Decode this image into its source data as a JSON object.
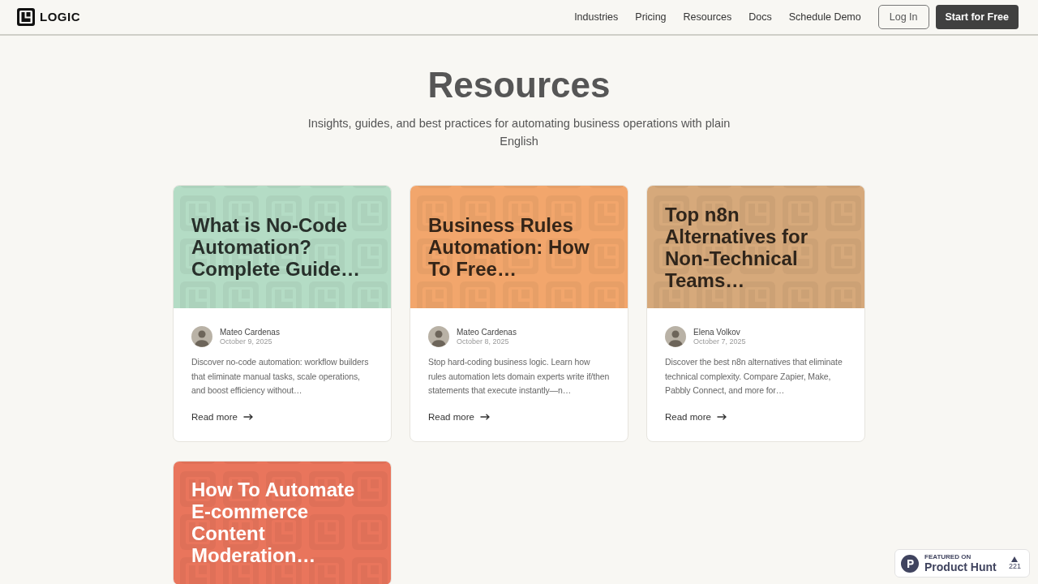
{
  "header": {
    "logo": "LOGIC",
    "nav": [
      "Industries",
      "Pricing",
      "Resources",
      "Docs",
      "Schedule Demo"
    ],
    "login": "Log In",
    "cta": "Start for Free"
  },
  "hero": {
    "title": "Resources",
    "subtitle": "Insights, guides, and best practices for automating business operations with plain English"
  },
  "posts": [
    {
      "title": "What is No-Code Automation? Complete Guide…",
      "color": "#b4dcc5",
      "author": "Mateo Cardenas",
      "date": "October 9, 2025",
      "excerpt": "Discover no-code automation: workflow builders that eliminate manual tasks, scale operations, and boost efficiency without…",
      "link": "Read more"
    },
    {
      "title": "Business Rules Automation: How To Free…",
      "color": "#f2a66c",
      "author": "Mateo Cardenas",
      "date": "October 8, 2025",
      "excerpt": "Stop hard-coding business logic. Learn how rules automation lets domain experts write if/then statements that execute instantly—n…",
      "link": "Read more"
    },
    {
      "title": "Top n8n Alternatives for Non-Technical Teams…",
      "color": "#d6a97b",
      "author": "Elena Volkov",
      "date": "October 7, 2025",
      "excerpt": "Discover the best n8n alternatives that eliminate technical complexity. Compare Zapier, Make, Pabbly Connect, and more for…",
      "link": "Read more"
    },
    {
      "title": "How To Automate E-commerce Content Moderation…",
      "color": "#e9755c"
    }
  ],
  "badge": {
    "kicker": "FEATURED ON",
    "name": "Product Hunt",
    "votes": "221"
  }
}
